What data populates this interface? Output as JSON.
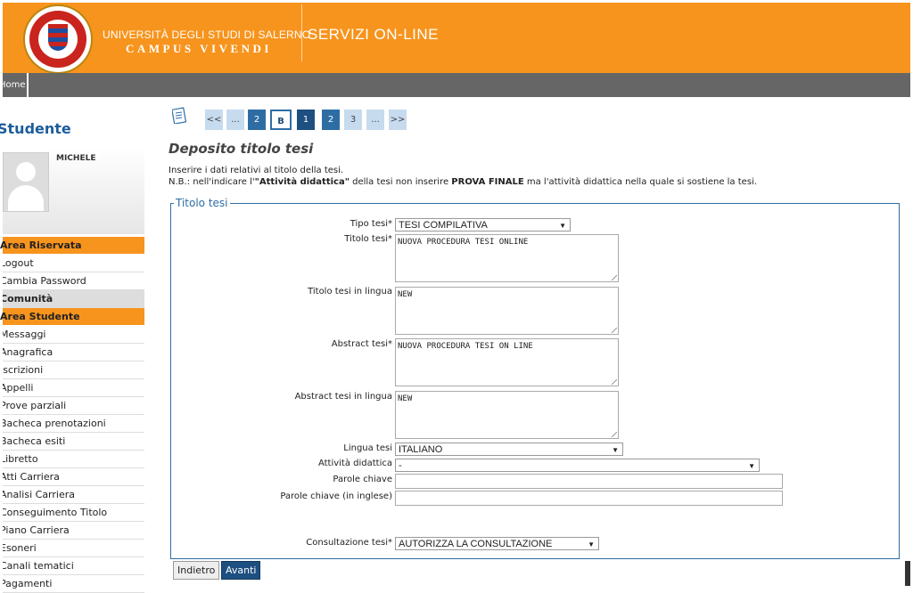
{
  "header": {
    "university": "UNIVERSITÀ DEGLI STUDI DI SALERNO",
    "motto": "CAMPUS VIVENDI",
    "services": "SERVIZI ON-LINE"
  },
  "nav": {
    "home": "Home"
  },
  "sidebar": {
    "title": "Studente",
    "user_name": "MICHELE",
    "sections": [
      {
        "label": "Area Riservata",
        "top": 0
      },
      {
        "label": "Area Studente"
      }
    ],
    "reserved_items": [
      "Logout",
      "Cambia Password",
      "Comunità"
    ],
    "student_items": [
      "Messaggi",
      "Anagrafica",
      "Iscrizioni",
      "Appelli",
      "Prove parziali",
      "Bacheca prenotazioni",
      "Bacheca esiti",
      "Libretto",
      "Atti Carriera",
      "Analisi Carriera",
      "Conseguimento Titolo",
      "Piano Carriera",
      "Esoneri",
      "Canali tematici",
      "Pagamenti"
    ]
  },
  "pager": {
    "items": [
      "<<",
      "...",
      "2",
      "B",
      "1",
      "2",
      "3",
      "...",
      ">>"
    ]
  },
  "page": {
    "title": "Deposito titolo tesi",
    "intro1": "Inserire i dati relativi al titolo della tesi.",
    "intro2_a": "N.B.: nell'indicare l'",
    "intro2_b": "\"Attività didattica\"",
    "intro2_c": " della tesi non inserire ",
    "intro2_d": "PROVA FINALE",
    "intro2_e": " ma l'attività didattica nella quale si sostiene la tesi."
  },
  "form": {
    "legend": "Titolo tesi",
    "tipo_label": "Tipo tesi*",
    "tipo_value": "TESI COMPILATIVA",
    "titolo_label": "Titolo tesi*",
    "titolo_value": "NUOVA PROCEDURA TESI ONLINE",
    "titolo_lingua_label": "Titolo tesi in lingua",
    "titolo_lingua_value": "NEW",
    "abstract_label": "Abstract tesi*",
    "abstract_value": "NUOVA PROCEDURA TESI ON LINE",
    "abstract_lingua_label": "Abstract tesi in lingua",
    "abstract_lingua_value": "NEW",
    "lingua_label": "Lingua tesi",
    "lingua_value": "ITALIANO",
    "attivita_label": "Attività didattica",
    "attivita_value": "-",
    "parole_label": "Parole chiave",
    "parole_value": "",
    "parole_en_label": "Parole chiave (in inglese)",
    "parole_en_value": "",
    "consult_label": "Consultazione tesi*",
    "consult_value": "AUTORIZZA LA CONSULTAZIONE"
  },
  "buttons": {
    "back": "Indietro",
    "next": "Avanti"
  }
}
